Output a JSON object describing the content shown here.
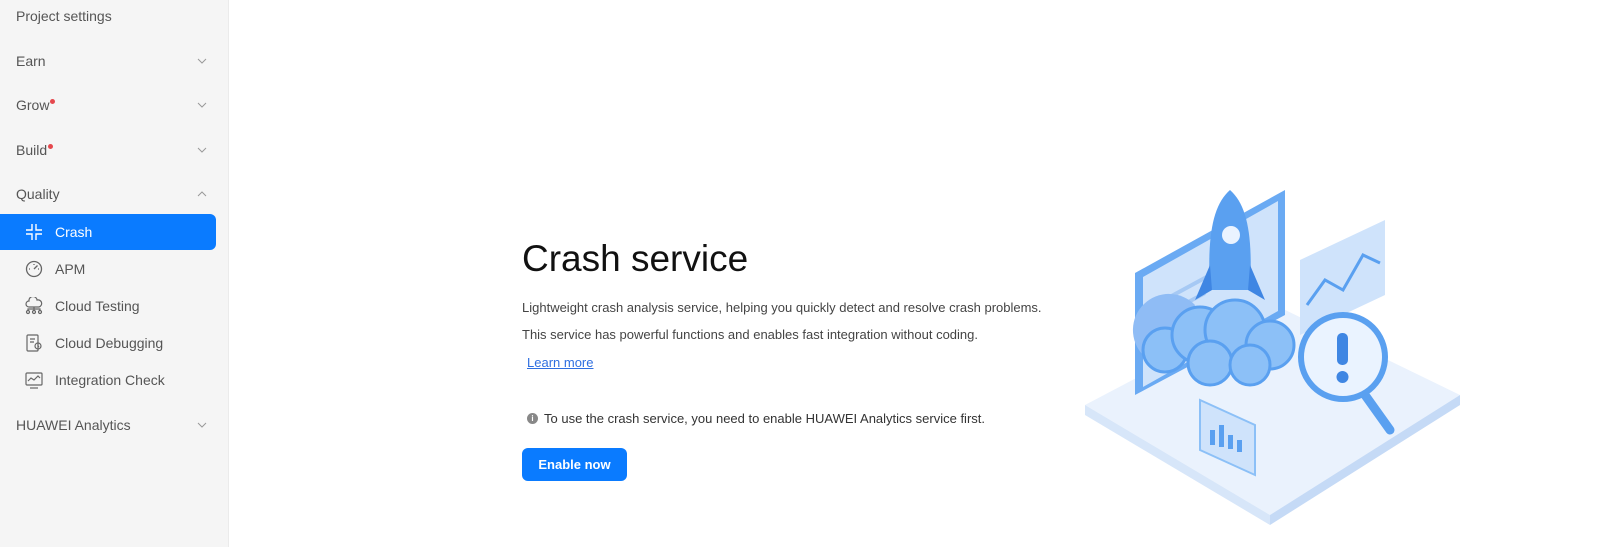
{
  "sidebar": {
    "top_label": "Project settings",
    "groups": [
      {
        "label": "Earn",
        "dot": false
      },
      {
        "label": "Grow",
        "dot": true
      },
      {
        "label": "Build",
        "dot": true
      },
      {
        "label": "Quality",
        "dot": false
      },
      {
        "label": "HUAWEI Analytics",
        "dot": false
      }
    ],
    "quality_items": [
      {
        "label": "Crash",
        "icon": "crash-icon",
        "active": true
      },
      {
        "label": "APM",
        "icon": "gauge-icon",
        "active": false
      },
      {
        "label": "Cloud Testing",
        "icon": "cloud-testing-icon",
        "active": false
      },
      {
        "label": "Cloud Debugging",
        "icon": "cloud-debugging-icon",
        "active": false
      },
      {
        "label": "Integration Check",
        "icon": "integration-check-icon",
        "active": false
      }
    ]
  },
  "main": {
    "title": "Crash service",
    "desc1": "Lightweight crash analysis service, helping you quickly detect and resolve crash problems.",
    "desc2": "This service has powerful functions and enables fast integration without coding.",
    "learn_more": "Learn more",
    "notice": "To use the crash service, you need to enable HUAWEI Analytics service first.",
    "enable_button": "Enable now"
  },
  "colors": {
    "accent": "#0a7bff",
    "badge_dot": "#e5484d",
    "illustration_blue": "#5aa0f0"
  }
}
